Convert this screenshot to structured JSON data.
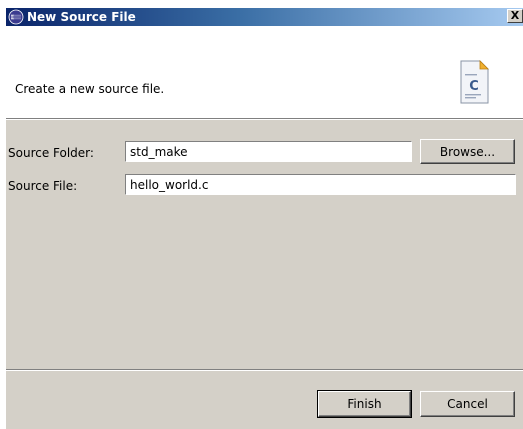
{
  "window": {
    "title": "New Source File",
    "icon": "eclipse-icon",
    "close_label": "X"
  },
  "header": {
    "message": "Create a new source file.",
    "image_icon": "c-source-file-icon",
    "image_letter": "C"
  },
  "form": {
    "source_folder_label": "Source Folder:",
    "source_folder_value": "std_make",
    "browse_label": "Browse...",
    "source_file_label": "Source File:",
    "source_file_value": "hello_world.c"
  },
  "footer": {
    "finish_label": "Finish",
    "cancel_label": "Cancel"
  }
}
